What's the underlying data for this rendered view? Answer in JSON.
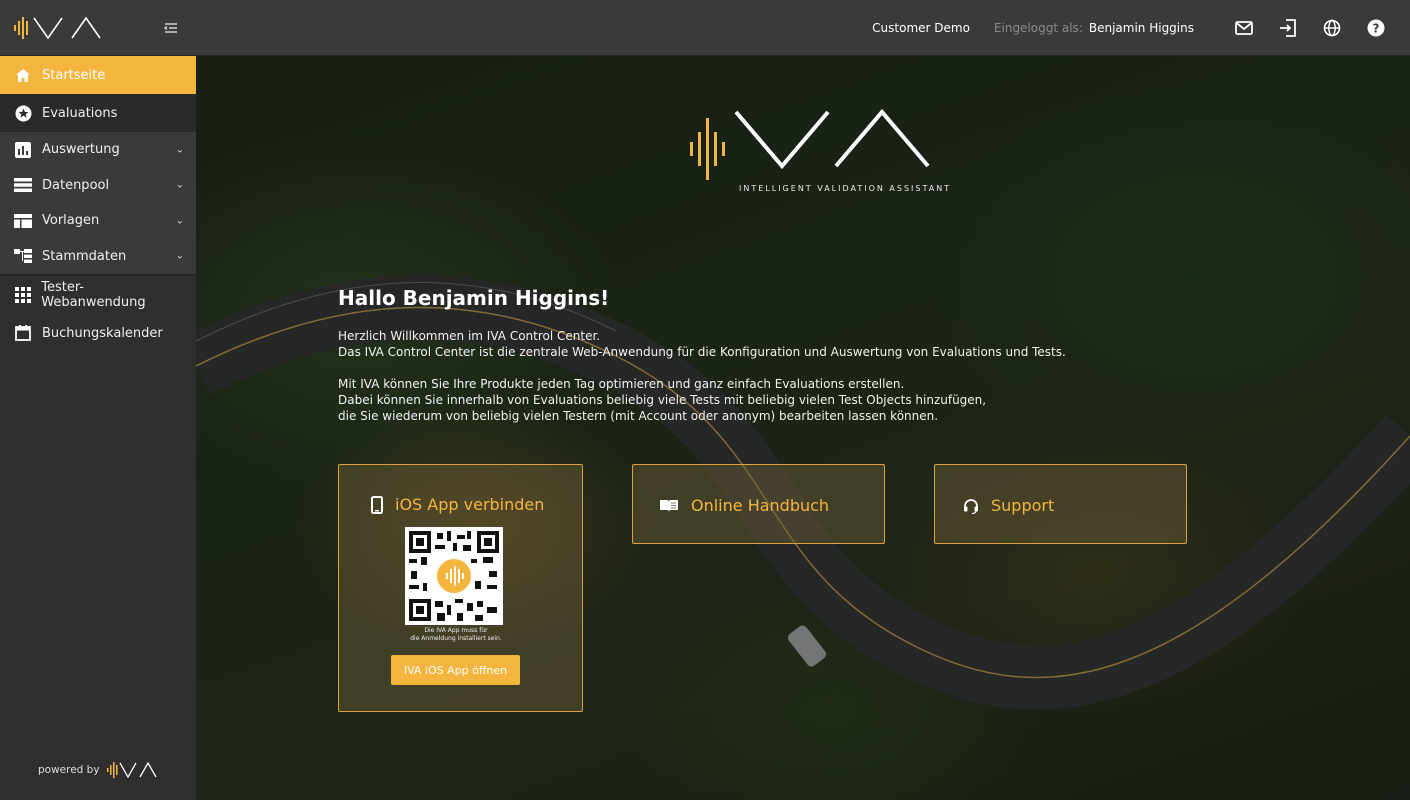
{
  "app": {
    "brand": "IVA",
    "tagline": "INTELLIGENT VALIDATION ASSISTANT"
  },
  "sidebar": {
    "items": [
      {
        "label": "Startseite",
        "icon": "home-icon",
        "active": true
      },
      {
        "label": "Evaluations",
        "icon": "star-circle-icon"
      },
      {
        "label": "Auswertung",
        "icon": "bar-chart-icon",
        "expandable": true
      },
      {
        "label": "Datenpool",
        "icon": "list-icon",
        "expandable": true
      },
      {
        "label": "Vorlagen",
        "icon": "template-icon",
        "expandable": true
      },
      {
        "label": "Stammdaten",
        "icon": "hierarchy-icon",
        "expandable": true
      },
      {
        "label": "Tester-Webanwendung",
        "icon": "grid-icon"
      },
      {
        "label": "Buchungskalender",
        "icon": "calendar-icon"
      }
    ],
    "powered_by": "powered by"
  },
  "topbar": {
    "customer": "Customer Demo",
    "logged_in_label": "Eingeloggt als:",
    "user_name": "Benjamin Higgins",
    "icons": [
      "mail-icon",
      "logout-icon",
      "globe-icon",
      "help-icon"
    ]
  },
  "main": {
    "greeting": "Hallo Benjamin Higgins!",
    "intro": [
      "Herzlich Willkommen im IVA Control Center.",
      "Das IVA Control Center ist die zentrale Web-Anwendung für die Konfiguration und Auswertung von Evaluations und Tests.",
      "Mit IVA können Sie Ihre Produkte jeden Tag optimieren und ganz einfach Evaluations erstellen.",
      "Dabei können Sie innerhalb von Evaluations beliebig viele Tests mit beliebig vielen Test Objects hinzufügen,",
      "die Sie wiederum von beliebig vielen Testern (mit Account oder anonym) bearbeiten lassen können."
    ],
    "cards": {
      "ios": {
        "title": "iOS App verbinden",
        "note_line1": "Die IVA App muss für",
        "note_line2": "die Anmeldung installiert sein.",
        "button": "IVA iOS App öffnen"
      },
      "manual": {
        "title": "Online Handbuch"
      },
      "support": {
        "title": "Support"
      }
    }
  },
  "colors": {
    "accent": "#f4b53f",
    "sidebar_bg": "#2f2f2f",
    "topbar_bg": "#3a3a3a"
  }
}
